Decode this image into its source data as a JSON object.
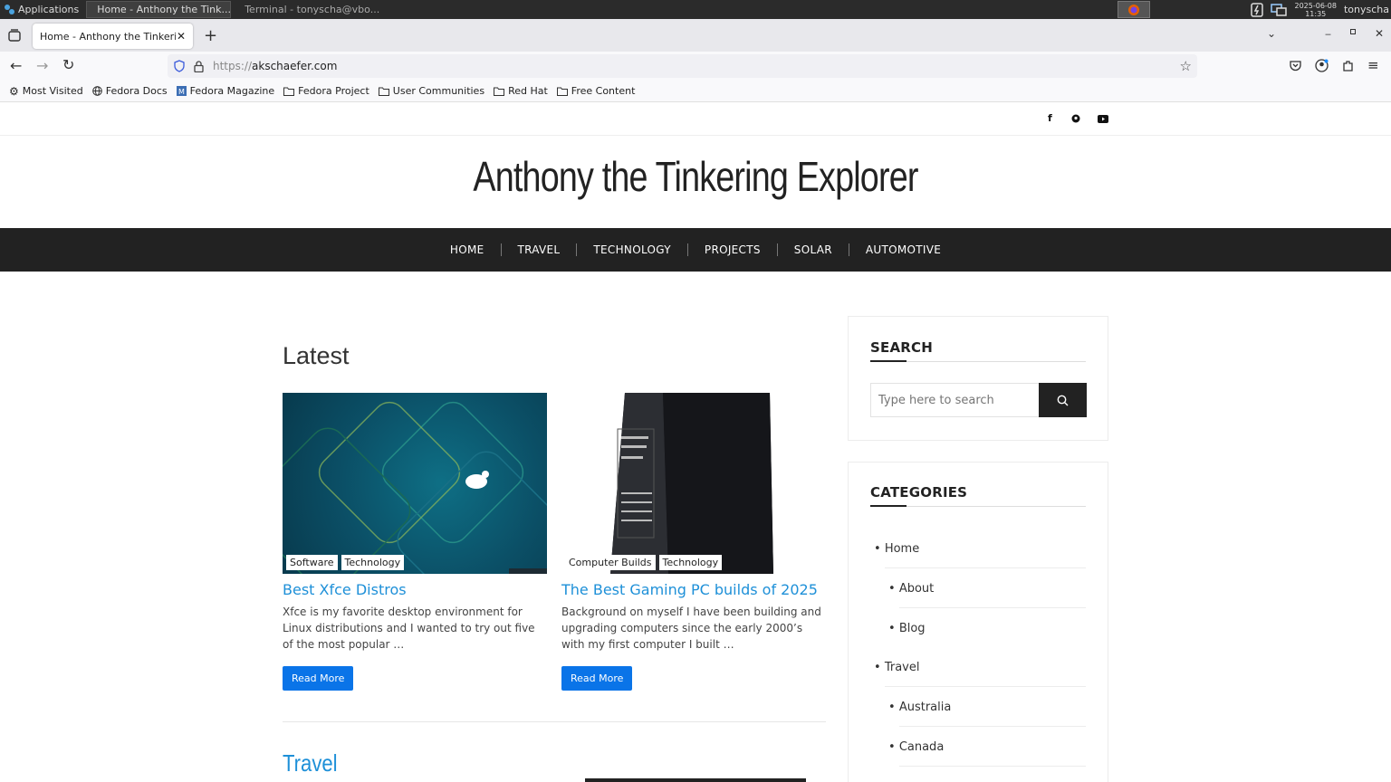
{
  "taskbar": {
    "apps_label": "Applications",
    "task1": "Home - Anthony the Tink...",
    "task2": "Terminal - tonyscha@vbo...",
    "clock_date": "2025-06-08",
    "clock_time": "11:35",
    "user": "tonyscha"
  },
  "browser": {
    "tab_title": "Home - Anthony the Tinkering",
    "url_prefix": "https://",
    "url_domain": "akschaefer.com",
    "bookmarks": [
      "Most Visited",
      "Fedora Docs",
      "Fedora Magazine",
      "Fedora Project",
      "User Communities",
      "Red Hat",
      "Free Content"
    ]
  },
  "site": {
    "title": "Anthony the Tinkering Explorer",
    "nav": [
      "HOME",
      "TRAVEL",
      "TECHNOLOGY",
      "PROJECTS",
      "SOLAR",
      "AUTOMOTIVE"
    ],
    "latest_heading": "Latest",
    "posts": [
      {
        "categories": [
          "Software",
          "Technology"
        ],
        "title": "Best Xfce Distros",
        "excerpt": "Xfce is my favorite desktop environment for Linux distributions and I wanted to try out five of the most popular …",
        "read_more": "Read More"
      },
      {
        "categories": [
          "Computer Builds",
          "Technology"
        ],
        "title": "The Best Gaming PC builds of 2025",
        "excerpt": "Background on myself I have been building and upgrading computers since the early 2000’s with my first computer I built …",
        "read_more": "Read More"
      }
    ],
    "travel_heading": "Travel"
  },
  "sidebar": {
    "search_title": "SEARCH",
    "search_placeholder": "Type here to search",
    "categories_title": "CATEGORIES",
    "categories": [
      "Home",
      "About",
      "Blog",
      "Travel",
      "Australia",
      "Canada"
    ]
  }
}
